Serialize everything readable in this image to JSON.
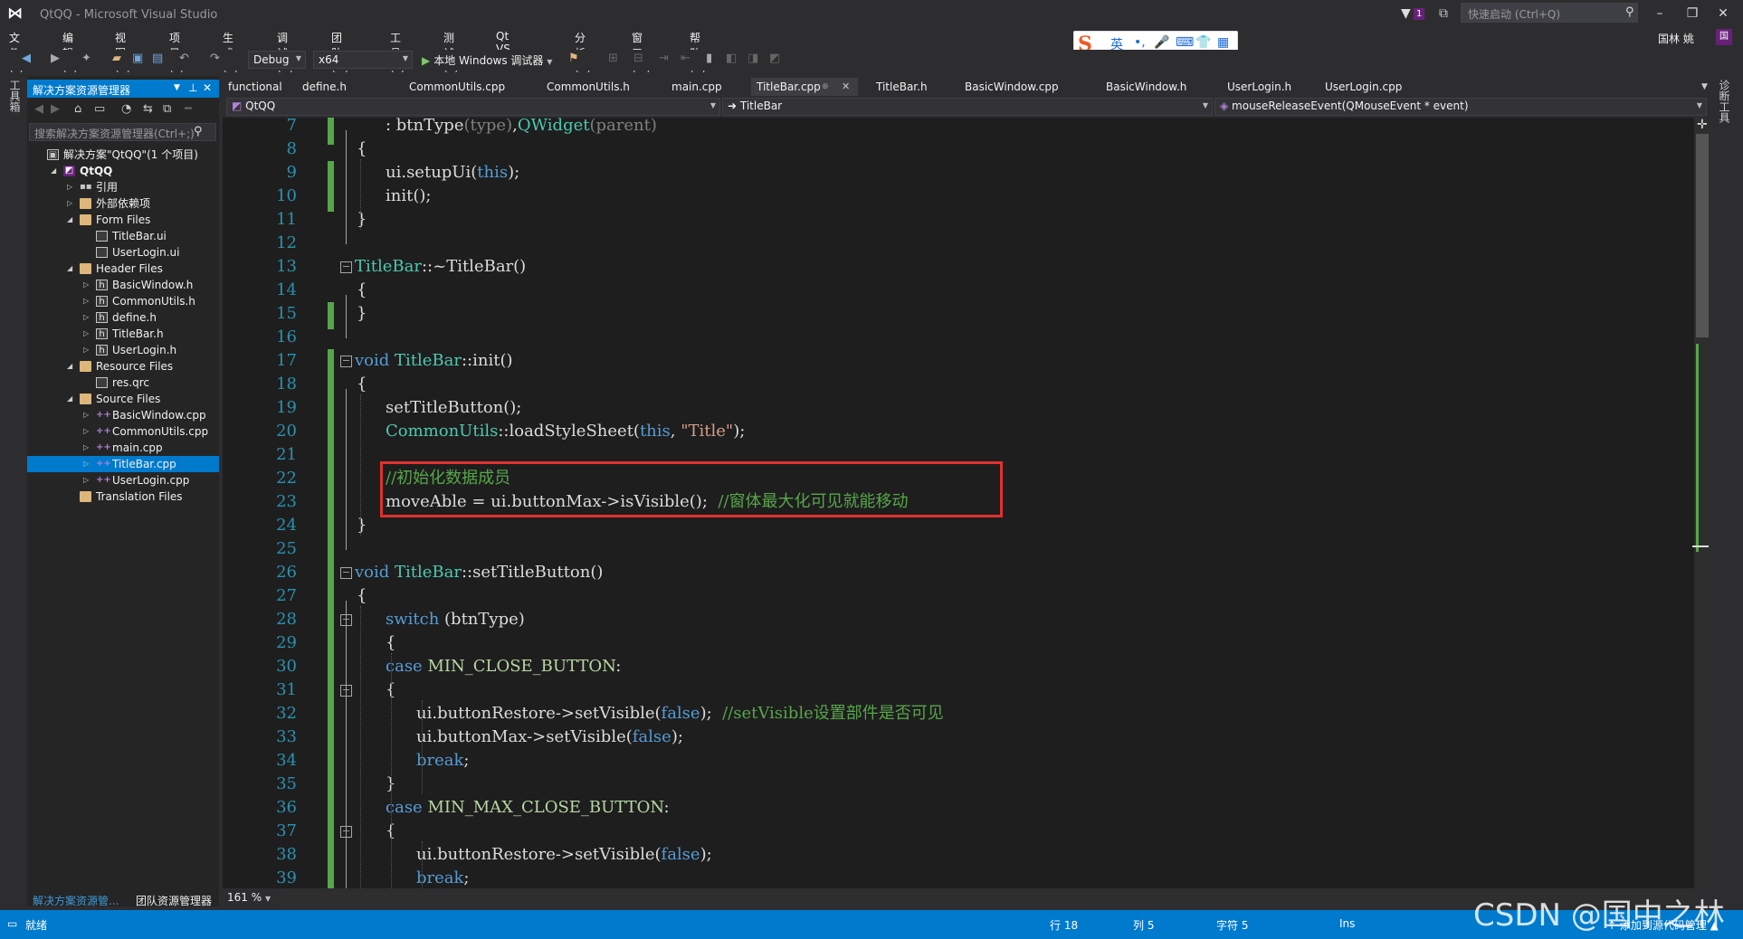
{
  "window": {
    "title": "QtQQ - Microsoft Visual Studio",
    "notification_count": "1",
    "quick_launch_placeholder": "快速启动 (Ctrl+Q)",
    "user": "国林 姚",
    "user_initial": "国"
  },
  "ime": {
    "items": [
      "英",
      "•,",
      "🎤",
      "⌨",
      "👕",
      "▦"
    ]
  },
  "menu": [
    "文件(F)",
    "编辑(E)",
    "视图(V)",
    "项目(P)",
    "生成(B)",
    "调试(D)",
    "团队(M)",
    "工具(T)",
    "测试(S)",
    "Qt VS Tools",
    "分析(N)",
    "窗口(W)",
    "帮助(H)"
  ],
  "toolbar": {
    "configuration": "Debug",
    "platform": "x64",
    "run_label": "本地 Windows 调试器"
  },
  "side_left_label": "工具箱",
  "side_right_label": "诊断工具",
  "solution_explorer": {
    "title": "解决方案资源管理器",
    "search_placeholder": "搜索解决方案资源管理器(Ctrl+;)",
    "tree": [
      {
        "label": "解决方案\"QtQQ\"(1 个项目)",
        "icon": "solution-icon",
        "level": 0,
        "arrow": ""
      },
      {
        "label": "QtQQ",
        "icon": "project-icon",
        "level": 1,
        "arrow": "open",
        "bold": true
      },
      {
        "label": "引用",
        "icon": "references-icon",
        "level": 2,
        "arrow": "closed"
      },
      {
        "label": "外部依赖项",
        "icon": "folder-icon",
        "level": 2,
        "arrow": "closed"
      },
      {
        "label": "Form Files",
        "icon": "folder-icon",
        "level": 2,
        "arrow": "open"
      },
      {
        "label": "TitleBar.ui",
        "icon": "file-icon",
        "level": 3,
        "arrow": ""
      },
      {
        "label": "UserLogin.ui",
        "icon": "file-icon",
        "level": 3,
        "arrow": ""
      },
      {
        "label": "Header Files",
        "icon": "folder-icon",
        "level": 2,
        "arrow": "open"
      },
      {
        "label": "BasicWindow.h",
        "icon": "header-file-icon",
        "level": 3,
        "arrow": "closed"
      },
      {
        "label": "CommonUtils.h",
        "icon": "header-file-icon",
        "level": 3,
        "arrow": "closed"
      },
      {
        "label": "define.h",
        "icon": "header-file-icon",
        "level": 3,
        "arrow": "closed"
      },
      {
        "label": "TitleBar.h",
        "icon": "header-file-icon",
        "level": 3,
        "arrow": "closed"
      },
      {
        "label": "UserLogin.h",
        "icon": "header-file-icon",
        "level": 3,
        "arrow": "closed"
      },
      {
        "label": "Resource Files",
        "icon": "folder-icon",
        "level": 2,
        "arrow": "open"
      },
      {
        "label": "res.qrc",
        "icon": "file-icon",
        "level": 3,
        "arrow": ""
      },
      {
        "label": "Source Files",
        "icon": "folder-icon",
        "level": 2,
        "arrow": "open"
      },
      {
        "label": "BasicWindow.cpp",
        "icon": "cpp-file-icon",
        "level": 3,
        "arrow": "closed"
      },
      {
        "label": "CommonUtils.cpp",
        "icon": "cpp-file-icon",
        "level": 3,
        "arrow": "closed"
      },
      {
        "label": "main.cpp",
        "icon": "cpp-file-icon",
        "level": 3,
        "arrow": "closed"
      },
      {
        "label": "TitleBar.cpp",
        "icon": "cpp-file-icon",
        "level": 3,
        "arrow": "closed",
        "selected": true
      },
      {
        "label": "UserLogin.cpp",
        "icon": "cpp-file-icon",
        "level": 3,
        "arrow": "closed"
      },
      {
        "label": "Translation Files",
        "icon": "folder-icon",
        "level": 2,
        "arrow": ""
      }
    ],
    "bottom_tabs": [
      "解决方案资源管...",
      "团队资源管理器"
    ]
  },
  "doc_tabs": [
    {
      "label": "functional"
    },
    {
      "label": "define.h"
    },
    {
      "label": "CommonUtils.cpp"
    },
    {
      "label": "CommonUtils.h"
    },
    {
      "label": "main.cpp"
    },
    {
      "label": "TitleBar.cpp",
      "active": true
    },
    {
      "label": "TitleBar.h"
    },
    {
      "label": "BasicWindow.cpp"
    },
    {
      "label": "BasicWindow.h"
    },
    {
      "label": "UserLogin.h"
    },
    {
      "label": "UserLogin.cpp"
    }
  ],
  "navbar": {
    "project": "QtQQ",
    "scope": "TitleBar",
    "member": "mouseReleaseEvent(QMouseEvent * event)"
  },
  "code": {
    "lines": [
      {
        "n": "7",
        "indent": 1,
        "tokens": [
          [
            "p",
            ": btnType"
          ],
          [
            "m",
            "(type)"
          ],
          [
            "p",
            ","
          ],
          [
            "t",
            "QWidget"
          ],
          [
            "m",
            "(parent)"
          ]
        ]
      },
      {
        "n": "8",
        "indent": 0,
        "tokens": [
          [
            "p",
            "{"
          ]
        ]
      },
      {
        "n": "9",
        "indent": 1,
        "tokens": [
          [
            "p",
            "ui.setupUi("
          ],
          [
            "k",
            "this"
          ],
          [
            "p",
            ");"
          ]
        ]
      },
      {
        "n": "10",
        "indent": 1,
        "tokens": [
          [
            "p",
            "init();"
          ]
        ]
      },
      {
        "n": "11",
        "indent": 0,
        "tokens": [
          [
            "p",
            "}"
          ]
        ]
      },
      {
        "n": "12",
        "indent": 0,
        "tokens": []
      },
      {
        "n": "13",
        "indent": 0,
        "tokens": [
          [
            "t",
            "TitleBar"
          ],
          [
            "p",
            "::~"
          ],
          [
            "p",
            "TitleBar()"
          ]
        ]
      },
      {
        "n": "14",
        "indent": 0,
        "tokens": [
          [
            "p",
            "{"
          ]
        ]
      },
      {
        "n": "15",
        "indent": 0,
        "tokens": [
          [
            "p",
            "}"
          ]
        ]
      },
      {
        "n": "16",
        "indent": 0,
        "tokens": []
      },
      {
        "n": "17",
        "indent": 0,
        "tokens": [
          [
            "k",
            "void "
          ],
          [
            "t",
            "TitleBar"
          ],
          [
            "p",
            "::init()"
          ]
        ]
      },
      {
        "n": "18",
        "indent": 0,
        "tokens": [
          [
            "p",
            "{"
          ]
        ]
      },
      {
        "n": "19",
        "indent": 1,
        "tokens": [
          [
            "p",
            "setTitleButton();"
          ]
        ]
      },
      {
        "n": "20",
        "indent": 1,
        "tokens": [
          [
            "t",
            "CommonUtils"
          ],
          [
            "p",
            "::loadStyleSheet("
          ],
          [
            "k",
            "this"
          ],
          [
            "p",
            ", "
          ],
          [
            "s",
            "\"Title\""
          ],
          [
            "p",
            ");"
          ]
        ]
      },
      {
        "n": "21",
        "indent": 0,
        "tokens": []
      },
      {
        "n": "22",
        "indent": 1,
        "tokens": [
          [
            "c",
            "//初始化数据成员"
          ]
        ]
      },
      {
        "n": "23",
        "indent": 1,
        "tokens": [
          [
            "p",
            "moveAble = ui.buttonMax->isVisible();  "
          ],
          [
            "c",
            "//窗体最大化可见就能移动"
          ]
        ]
      },
      {
        "n": "24",
        "indent": 0,
        "tokens": [
          [
            "p",
            "}"
          ]
        ]
      },
      {
        "n": "25",
        "indent": 0,
        "tokens": []
      },
      {
        "n": "26",
        "indent": 0,
        "tokens": [
          [
            "k",
            "void "
          ],
          [
            "t",
            "TitleBar"
          ],
          [
            "p",
            "::setTitleButton()"
          ]
        ]
      },
      {
        "n": "27",
        "indent": 0,
        "tokens": [
          [
            "p",
            "{"
          ]
        ]
      },
      {
        "n": "28",
        "indent": 1,
        "tokens": [
          [
            "k",
            "switch "
          ],
          [
            "p",
            "(btnType)"
          ]
        ]
      },
      {
        "n": "29",
        "indent": 1,
        "tokens": [
          [
            "p",
            "{"
          ]
        ]
      },
      {
        "n": "30",
        "indent": 1,
        "tokens": [
          [
            "k",
            "case "
          ],
          [
            "e",
            "MIN_CLOSE_BUTTON"
          ],
          [
            "p",
            ":"
          ]
        ]
      },
      {
        "n": "31",
        "indent": 1,
        "tokens": [
          [
            "p",
            "{"
          ]
        ]
      },
      {
        "n": "32",
        "indent": 2,
        "tokens": [
          [
            "p",
            "ui.buttonRestore->setVisible("
          ],
          [
            "k",
            "false"
          ],
          [
            "p",
            ");  "
          ],
          [
            "c",
            "//setVisible设置部件是否可见"
          ]
        ]
      },
      {
        "n": "33",
        "indent": 2,
        "tokens": [
          [
            "p",
            "ui.buttonMax->setVisible("
          ],
          [
            "k",
            "false"
          ],
          [
            "p",
            ");"
          ]
        ]
      },
      {
        "n": "34",
        "indent": 2,
        "tokens": [
          [
            "k",
            "break"
          ],
          [
            "p",
            ";"
          ]
        ]
      },
      {
        "n": "35",
        "indent": 1,
        "tokens": [
          [
            "p",
            "}"
          ]
        ]
      },
      {
        "n": "36",
        "indent": 1,
        "tokens": [
          [
            "k",
            "case "
          ],
          [
            "e",
            "MIN_MAX_CLOSE_BUTTON"
          ],
          [
            "p",
            ":"
          ]
        ]
      },
      {
        "n": "37",
        "indent": 1,
        "tokens": [
          [
            "p",
            "{"
          ]
        ]
      },
      {
        "n": "38",
        "indent": 2,
        "tokens": [
          [
            "p",
            "ui.buttonRestore->setVisible("
          ],
          [
            "k",
            "false"
          ],
          [
            "p",
            ");"
          ]
        ]
      },
      {
        "n": "39",
        "indent": 2,
        "tokens": [
          [
            "k",
            "break"
          ],
          [
            "p",
            ";"
          ]
        ]
      }
    ]
  },
  "zoom": "161 %",
  "status": {
    "ready": "就绪",
    "line": "行 18",
    "col": "列 5",
    "char": "字符 5",
    "mode": "Ins",
    "source_control": "↑ 添加到源代码管理 ▲"
  },
  "watermark": "CSDN @国中之林",
  "colors": {
    "accent": "#007acc",
    "highlight_box": "#e0312f",
    "change_bar": "#57a64a"
  }
}
